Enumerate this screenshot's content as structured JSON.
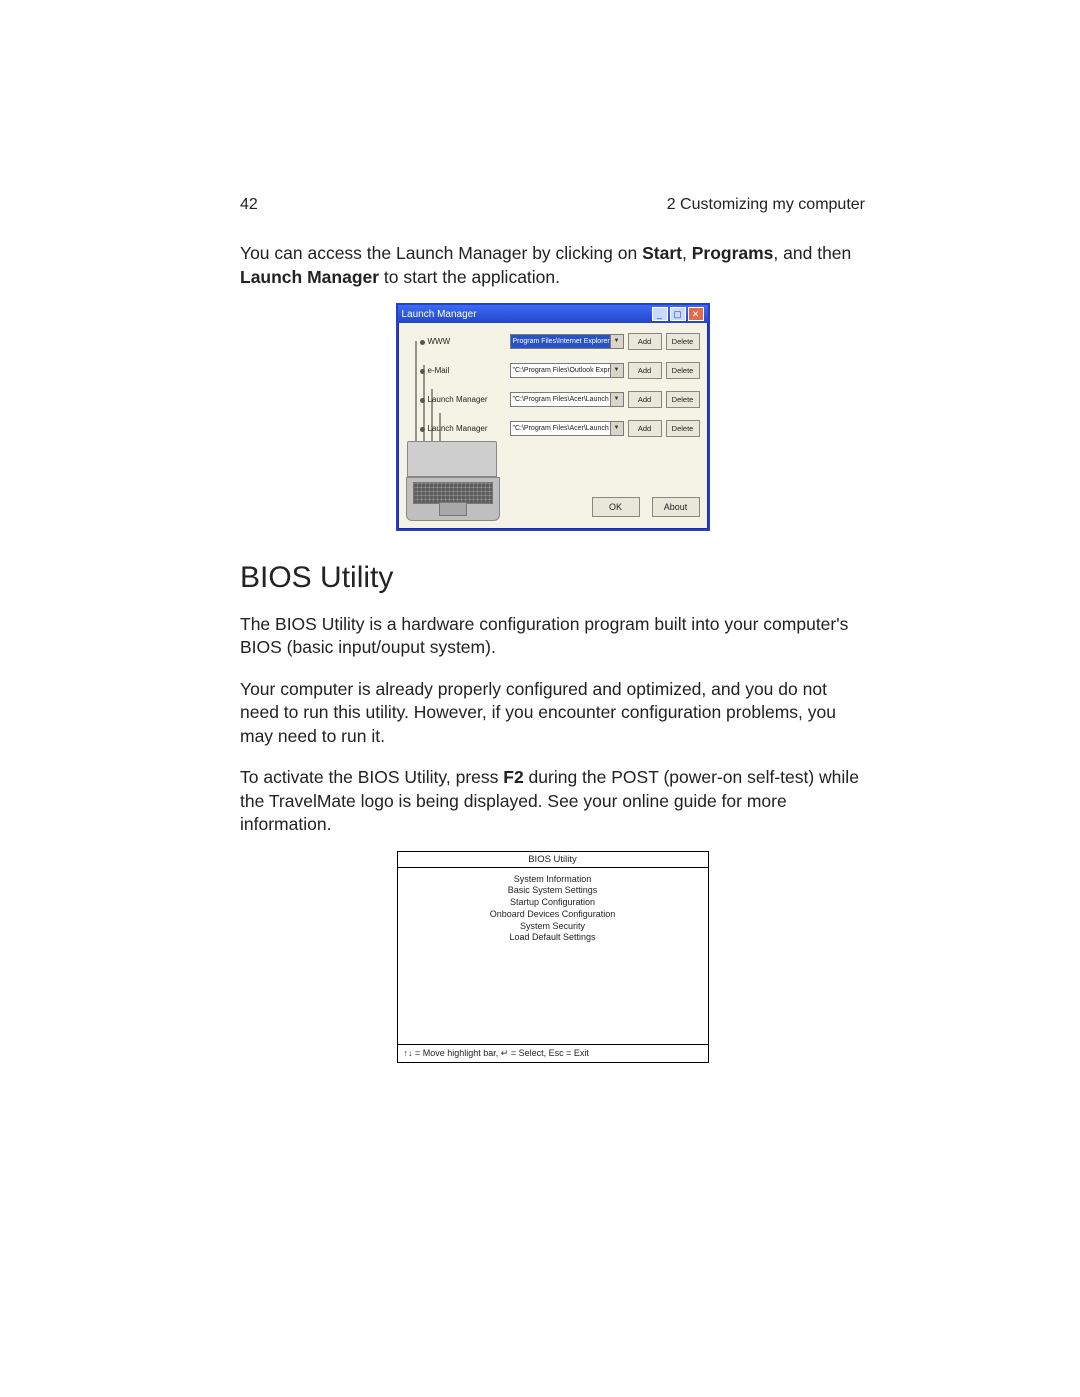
{
  "header": {
    "page_number": "42",
    "chapter": "2 Customizing my computer"
  },
  "intro": {
    "pre": "You can access the Launch Manager by clicking on ",
    "b1": "Start",
    "mid1": ", ",
    "b2": "Programs",
    "mid2": ", and then ",
    "b3": "Launch Manager",
    "post": " to start the application."
  },
  "lm": {
    "title": "Launch Manager",
    "rows": [
      {
        "label": "WWW",
        "path": "Program Files\\Internet Explorer\\iexplore.exe",
        "hl": true
      },
      {
        "label": "e-Mail",
        "path": "\"C:\\Program Files\\Outlook Express\\msimn.ex"
      },
      {
        "label": "Launch Manager",
        "path": "\"C:\\Program Files\\Acer\\Launch Manager\\Qt"
      },
      {
        "label": "Launch Manager",
        "path": "\"C:\\Program Files\\Acer\\Launch Manager\\Qt"
      }
    ],
    "add": "Add",
    "del": "Delete",
    "ok": "OK",
    "about": "About"
  },
  "bios": {
    "heading": "BIOS Utility",
    "p1": "The BIOS Utility is a hardware configuration program built into your computer's BIOS (basic input/ouput system).",
    "p2": "Your computer is already properly configured and optimized, and you do not need to run this utility.  However, if you encounter configuration problems, you may need to run it.",
    "p3_pre": "To activate the BIOS Utility, press ",
    "p3_key": "F2",
    "p3_post": " during the POST (power-on self-test)  while the TravelMate logo is being displayed.  See your online guide for more information.",
    "box_title": "BIOS Utility",
    "items": [
      "System Information",
      "Basic System Settings",
      "Startup Configuration",
      "Onboard Devices Configuration",
      "System Security",
      "Load Default Settings"
    ],
    "footer": "↑↓ = Move highlight bar, ↵ = Select, Esc = Exit"
  }
}
